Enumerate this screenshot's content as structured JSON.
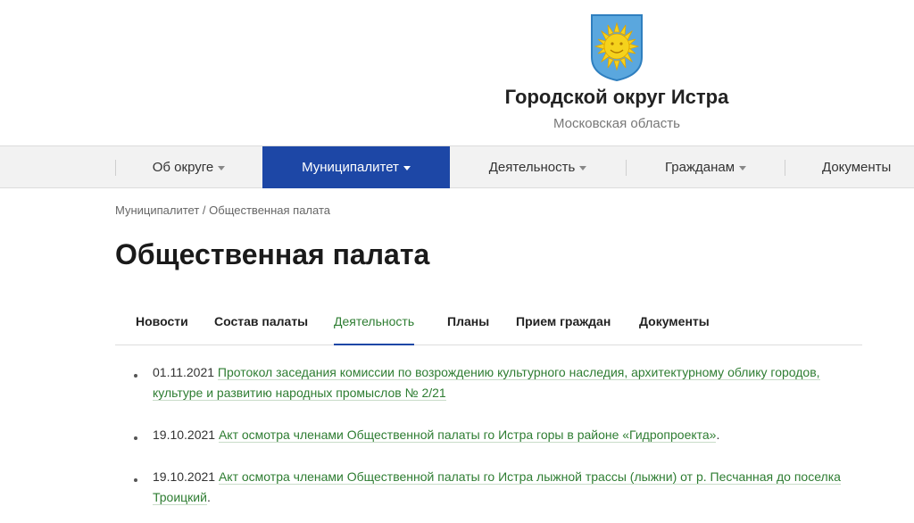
{
  "header": {
    "title": "Городской округ Истра",
    "subtitle": "Московская область",
    "logo_icon": "sun-coat-of-arms",
    "colors": {
      "shield": "#5aa7de",
      "sun": "#f5d21c",
      "sun_edge": "#e0a400"
    }
  },
  "nav": {
    "items": [
      {
        "label": "Об округе",
        "dropdown": true,
        "active": false
      },
      {
        "label": "Муниципалитет",
        "dropdown": true,
        "active": true
      },
      {
        "label": "Деятельность",
        "dropdown": true,
        "active": false
      },
      {
        "label": "Гражданам",
        "dropdown": true,
        "active": false
      },
      {
        "label": "Документы",
        "dropdown": false,
        "active": false
      }
    ],
    "active_color": "#1d47a6"
  },
  "breadcrumb": "Муниципалитет / Общественная палата",
  "page": {
    "title": "Общественная палата"
  },
  "tabs": [
    {
      "label": "Новости",
      "active": false
    },
    {
      "label": "Состав палаты",
      "active": false
    },
    {
      "label": "Деятельность",
      "active": true
    },
    {
      "label": "Планы",
      "active": false
    },
    {
      "label": "Прием граждан",
      "active": false
    },
    {
      "label": "Документы",
      "active": false
    }
  ],
  "news": [
    {
      "date": "01.11.2021",
      "link_text": "Протокол заседания комиссии по возрождению культурного наследия, архитектурному облику городов, культуре и развитию народных промыслов № 2/21",
      "suffix": ""
    },
    {
      "date": "19.10.2021",
      "link_text": "Акт осмотра членами Общественной палаты го Истра горы в районе «Гидропроекта»",
      "suffix": "."
    },
    {
      "date": "19.10.2021",
      "link_text": "Акт осмотра членами Общественной палаты го Истра  лыжной трассы (лыжни) от р. Песчанная до поселка Троицкий",
      "suffix": "."
    }
  ],
  "link_color": "#2e7d32"
}
